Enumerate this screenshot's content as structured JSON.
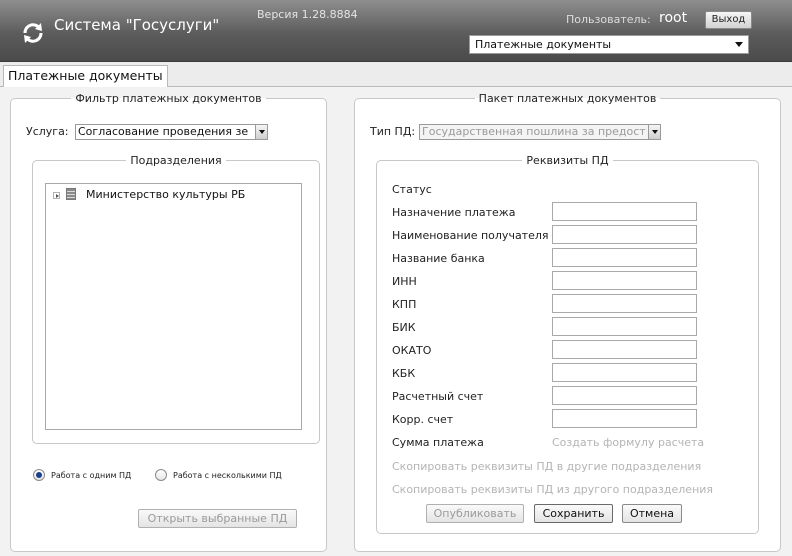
{
  "header": {
    "title": "Система \"Госуслуги\"",
    "version": "Версия 1.28.8884",
    "user_label": "Пользователь:",
    "user_name": "root",
    "logout": "Выход",
    "section": "Платежные документы"
  },
  "tabs": [
    {
      "label": "Платежные документы"
    }
  ],
  "filter": {
    "legend": "Фильтр платежных документов",
    "service_label": "Услуга:",
    "service_value": "Согласование проведения зе",
    "subdivisions_legend": "Подразделения",
    "tree_items": [
      {
        "label": "Министерство культуры РБ"
      }
    ],
    "mode_single": "Работа с одним ПД",
    "mode_multi": "Работа с несколькими ПД",
    "mode_selected": "single",
    "open_selected": "Открыть выбранные ПД"
  },
  "package": {
    "legend": "Пакет платежных документов",
    "type_label": "Тип ПД:",
    "type_value": "Государственная пошлина за предост",
    "reqs_legend": "Реквизиты ПД",
    "status_label": "Статус",
    "fields": [
      {
        "label": "Назначение платежа",
        "value": ""
      },
      {
        "label": "Наименование получателя",
        "value": ""
      },
      {
        "label": "Название банка",
        "value": ""
      },
      {
        "label": "ИНН",
        "value": ""
      },
      {
        "label": "КПП",
        "value": ""
      },
      {
        "label": "БИК",
        "value": ""
      },
      {
        "label": "ОКАТО",
        "value": ""
      },
      {
        "label": "КБК",
        "value": ""
      },
      {
        "label": "Расчетный счет",
        "value": ""
      },
      {
        "label": "Корр. счет",
        "value": ""
      }
    ],
    "sum_label": "Сумма платежа",
    "create_formula": "Создать формулу расчета",
    "copy_to_other": "Скопировать реквизиты ПД в другие подразделения",
    "copy_from_other": "Скопировать реквизиты ПД из другого подразделения",
    "publish": "Опубликовать",
    "save": "Сохранить",
    "cancel": "Отмена"
  },
  "colors": {
    "header_dark": "#4a4a4a",
    "radio_dot": "#1b3f8c",
    "disabled_text": "#b4b4b4"
  }
}
